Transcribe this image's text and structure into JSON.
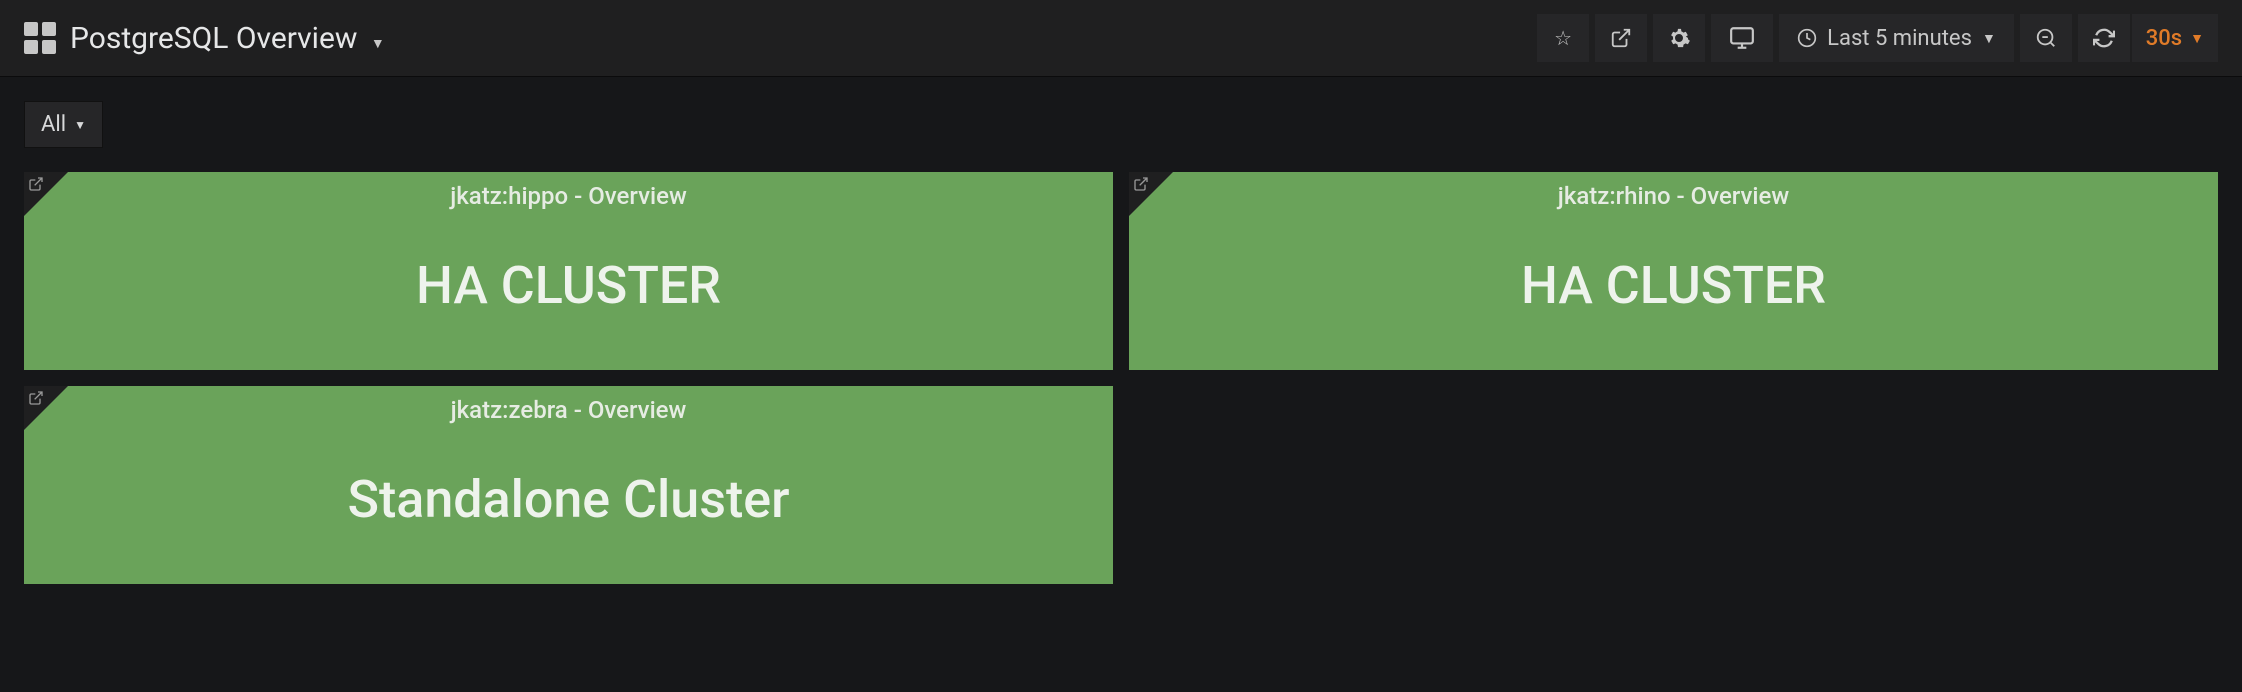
{
  "header": {
    "title": "PostgreSQL Overview",
    "timeRange": "Last 5 minutes",
    "refreshInterval": "30s"
  },
  "filter": {
    "value": "All"
  },
  "panels": [
    {
      "title": "jkatz:hippo - Overview",
      "value": "HA CLUSTER"
    },
    {
      "title": "jkatz:rhino - Overview",
      "value": "HA CLUSTER"
    },
    {
      "title": "jkatz:zebra - Overview",
      "value": "Standalone Cluster"
    }
  ]
}
